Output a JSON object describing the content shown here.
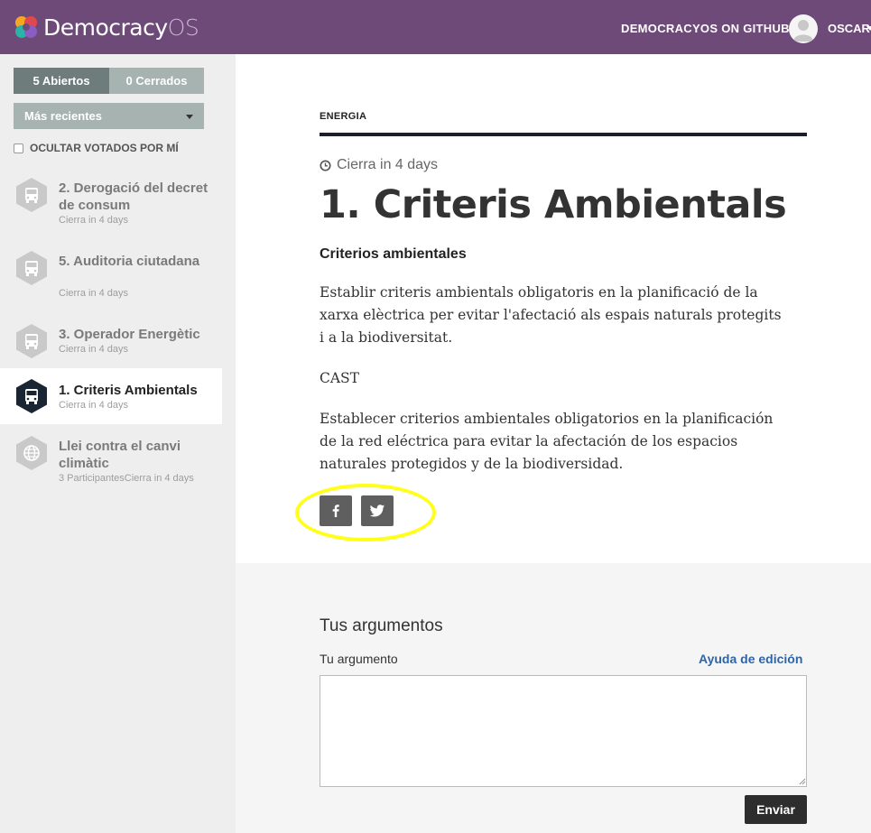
{
  "header": {
    "brand_main": "Democracy",
    "brand_suffix": "OS",
    "github_link": "DEMOCRACYOS ON GITHUB",
    "user_name": "OSCAR"
  },
  "sidebar": {
    "tab_open": "5 Abiertos",
    "tab_closed": "0 Cerrados",
    "sort_label": "Más recientes",
    "hide_voted_label": "OCULTAR VOTADOS POR MÍ",
    "topics": [
      {
        "title": "2. Derogació del decret de consum",
        "meta": "Cierra in 4 days",
        "icon": "bus-icon",
        "active": false
      },
      {
        "title": "5. Auditoria ciutadana",
        "meta": "Cierra in 4 days",
        "icon": "bus-icon",
        "active": false
      },
      {
        "title": "3. Operador Energètic",
        "meta": "Cierra in 4 days",
        "icon": "bus-icon",
        "active": false
      },
      {
        "title": "1. Criteris Ambientals",
        "meta": "Cierra in 4 days",
        "icon": "bus-icon",
        "active": true
      },
      {
        "title": "Llei contra el canvi climàtic",
        "meta": "3 ParticipantesCierra in 4 days",
        "icon": "globe-icon",
        "active": false
      }
    ]
  },
  "topic": {
    "category": "ENERGIA",
    "closes": "Cierra in 4 days",
    "title": "1. Criteris Ambientals",
    "subtitle": "Criterios ambientales",
    "paragraphs": [
      "Establir criteris ambientals obligatoris en la planificació de la xarxa elèctrica per evitar l'afectació als espais naturals protegits i a la biodiversitat.",
      "CAST",
      "Establecer criterios ambientales obligatorios en la planificación de la red eléctrica para evitar la afectación de los espacios naturales protegidos y de la biodiversidad."
    ],
    "share_icons": [
      "facebook-icon",
      "twitter-icon"
    ]
  },
  "arguments": {
    "title": "Tus argumentos",
    "label": "Tu argumento",
    "help_link": "Ayuda de edición",
    "textarea_value": "",
    "submit_label": "Enviar"
  },
  "colors": {
    "header_bg": "#6e4a78",
    "sidebar_bg": "#eeeeee",
    "tab_active": "#6e7d7b",
    "tab_inactive": "#a6b3b0",
    "hex_inactive": "#c9c9c9",
    "hex_active": "#1a2533",
    "link_blue": "#2f64a6",
    "highlight": "#ffff00"
  }
}
